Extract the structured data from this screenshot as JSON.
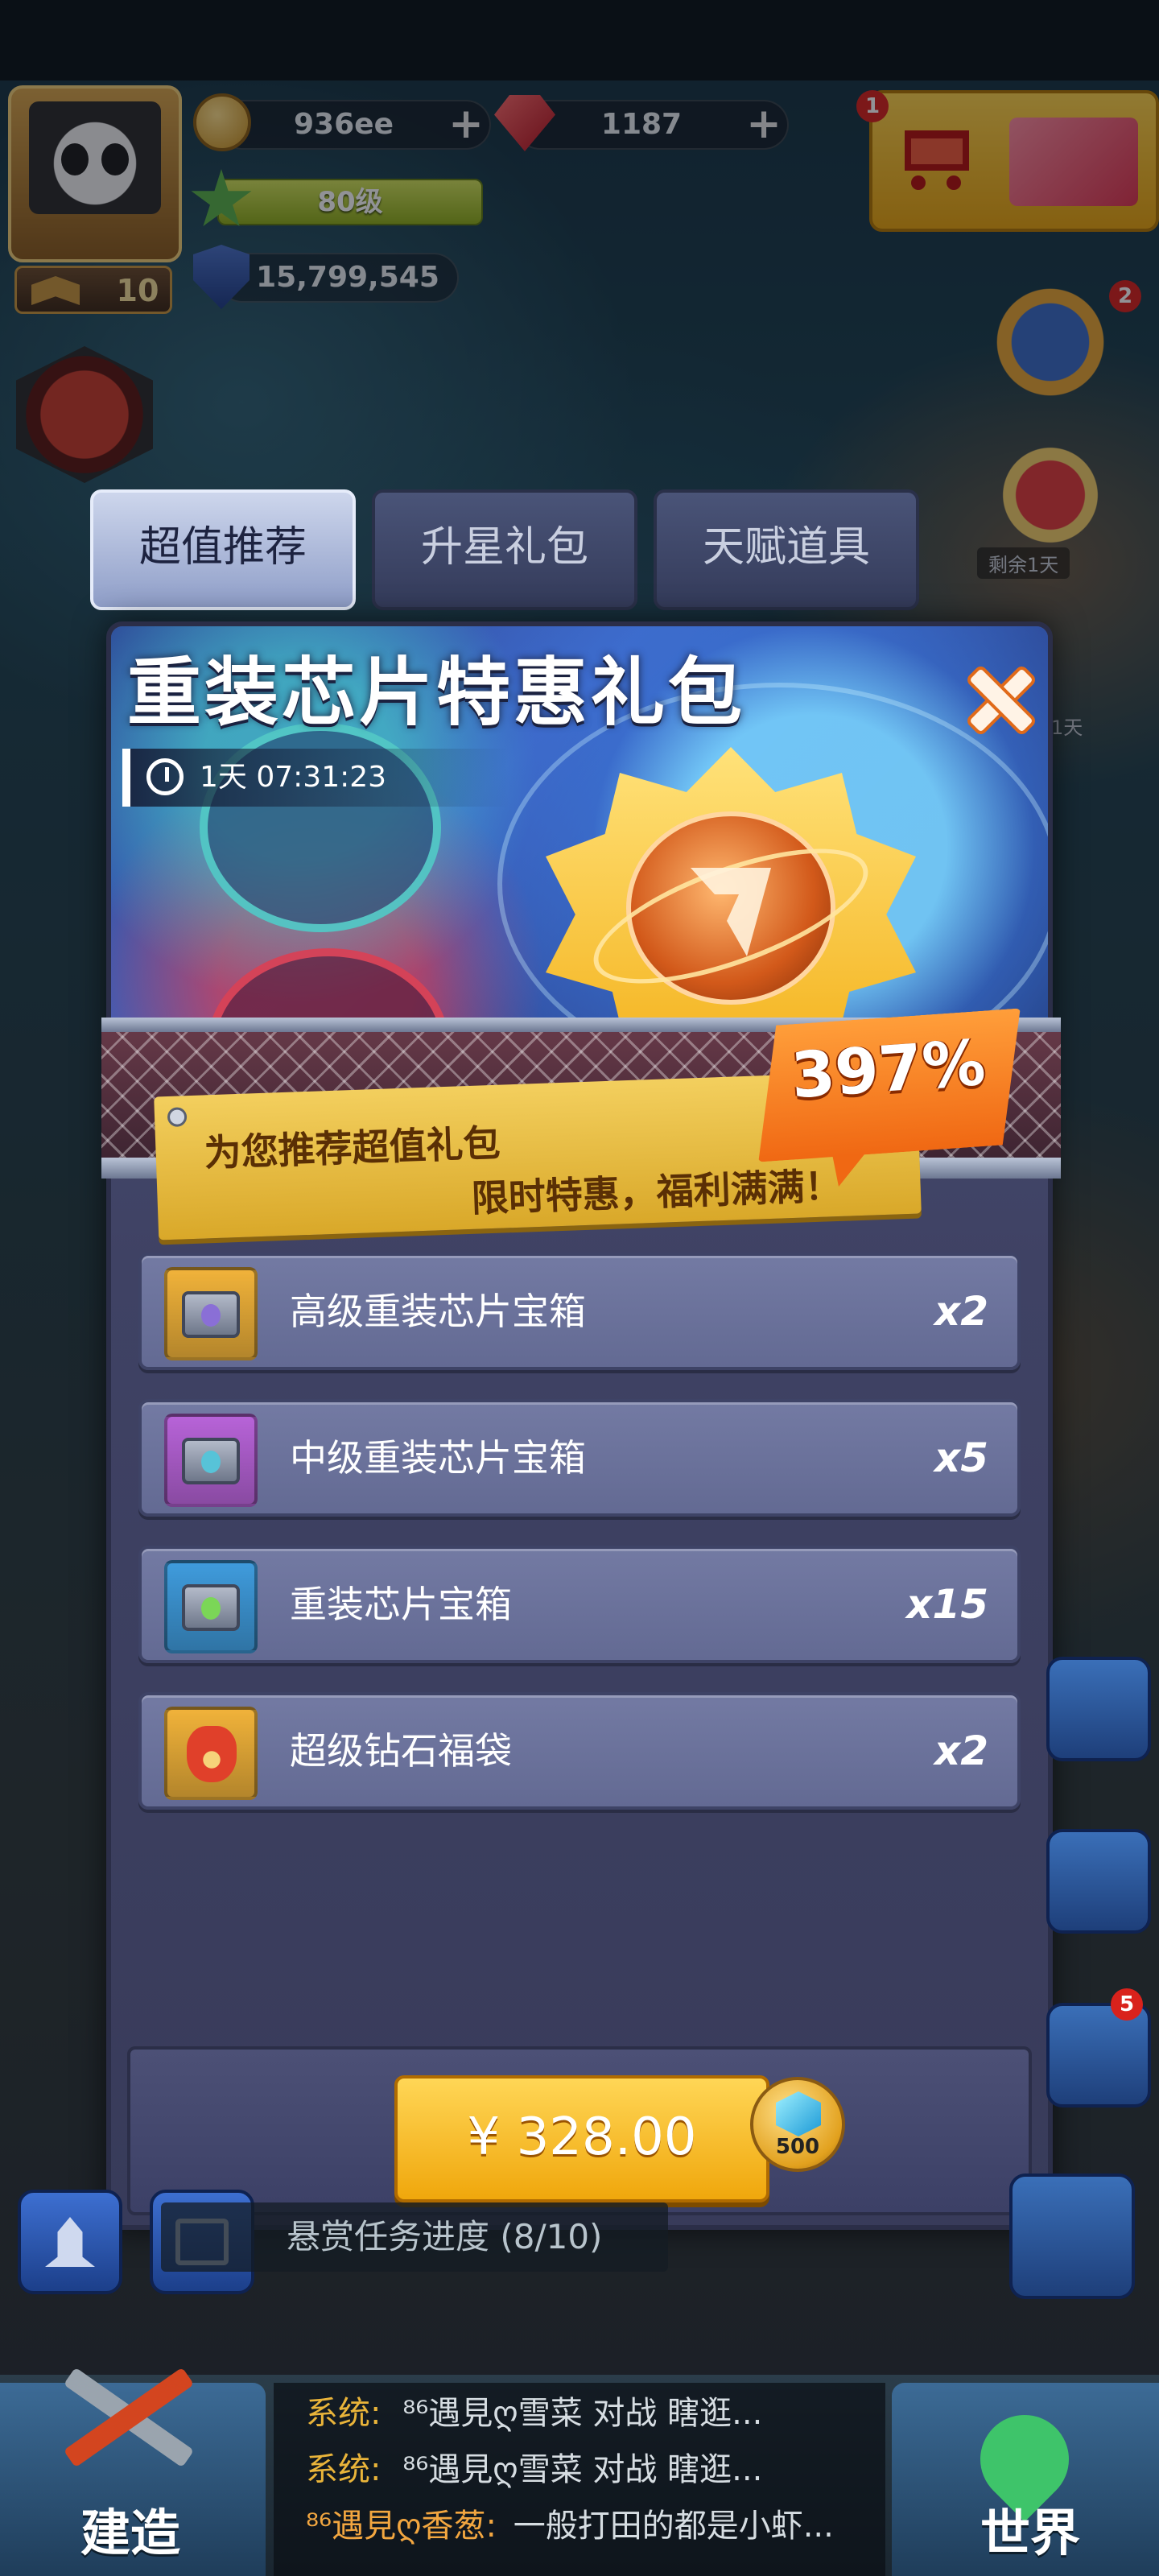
{
  "hud": {
    "coins": "936ee",
    "gems": "1187",
    "level": "80级",
    "power": "15,799,545",
    "avatar_level": "10",
    "shop_badge": "1",
    "side_badge": "2"
  },
  "tabs": [
    {
      "label": "超值推荐",
      "active": true
    },
    {
      "label": "升星礼包",
      "active": false
    },
    {
      "label": "天赋道具",
      "active": false
    }
  ],
  "side": {
    "remaining_1": "剩余1天",
    "remaining_2": "1天",
    "mail_badge": "5"
  },
  "dialog": {
    "title": "重装芯片特惠礼包",
    "timer": "1天  07:31:23",
    "discount": "397%",
    "ribbon_line1": "为您推荐超值礼包",
    "ribbon_line2": "限时特惠，福利满满！",
    "items": [
      {
        "name": "高级重装芯片宝箱",
        "qty": "x2",
        "icon_color": "#f0b23a",
        "core_color": "#8a6fd6"
      },
      {
        "name": "中级重装芯片宝箱",
        "qty": "x5",
        "icon_color": "#b763d8",
        "core_color": "#57c3d8"
      },
      {
        "name": "重装芯片宝箱",
        "qty": "x15",
        "icon_color": "#3f9bdc",
        "core_color": "#7bd657"
      },
      {
        "name": "超级钻石福袋",
        "qty": "x2",
        "icon_color": "#f0b23a",
        "core_color": "#e0402a"
      }
    ],
    "price": "¥ 328.00",
    "bonus_gems": "500"
  },
  "bottom": {
    "quest": "悬赏任务进度 (8/10)",
    "build_label": "建造",
    "world_label": "世界",
    "chat": [
      {
        "sys": "系统:",
        "text": "⁸⁶遇見ღ雪菜 对战 瞎逛..."
      },
      {
        "sys": "系统:",
        "text": "⁸⁶遇見ღ雪菜 对战 瞎逛..."
      },
      {
        "sys": "⁸⁶遇見ღ香葱:",
        "text": "一般打田的都是小虾..."
      }
    ]
  }
}
